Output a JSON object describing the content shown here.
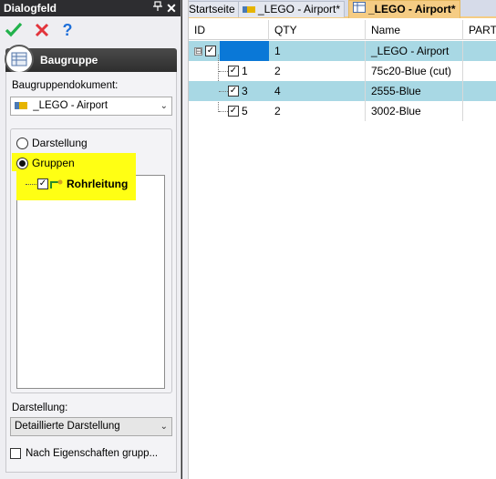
{
  "dialog": {
    "title": "Dialogfeld",
    "pin_icon": "pin-icon",
    "close_icon": "close-icon",
    "toolbar": {
      "ok_icon": "check-icon",
      "cancel_icon": "x-icon",
      "help_icon": "help-icon"
    },
    "group_title": "Baugruppe",
    "doc_label": "Baugruppendokument:",
    "doc_value": "_LEGO - Airport",
    "radio_darstellung": "Darstellung",
    "radio_gruppen": "Gruppen",
    "radio_selected": "Gruppen",
    "tree_item": "Rohrleitung",
    "darstellung_label": "Darstellung:",
    "darstellung_value": "Detaillierte Darstellung",
    "nach_checkbox": "Nach  Eigenschaften grupp..."
  },
  "colors": {
    "highlight": "#ffff14",
    "selection": "#a8d8e4",
    "active_tab": "#f5cc84",
    "accent_blue": "#0a78d7"
  },
  "tabs": [
    {
      "label": "Startseite"
    },
    {
      "label": "_LEGO - Airport*"
    },
    {
      "label": "_LEGO - Airport*",
      "active": true
    }
  ],
  "grid": {
    "columns": [
      "ID",
      "QTY",
      "Name",
      "PART"
    ],
    "rows": [
      {
        "id": "",
        "qty": "1",
        "name": "_LEGO - Airport",
        "selected": true,
        "expander": "⊟"
      },
      {
        "id": "1",
        "qty": "2",
        "name": "75c20-Blue (cut)",
        "selected": false
      },
      {
        "id": "3",
        "qty": "4",
        "name": "2555-Blue",
        "selected": true
      },
      {
        "id": "5",
        "qty": "2",
        "name": "3002-Blue",
        "selected": false
      }
    ]
  }
}
